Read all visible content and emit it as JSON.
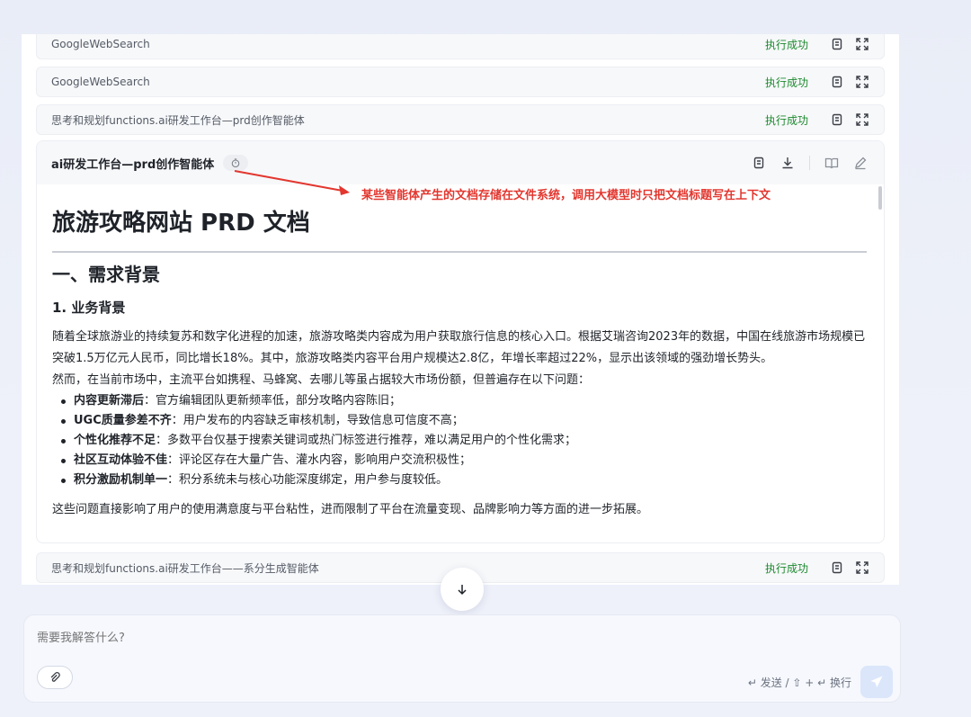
{
  "tool_rows": [
    {
      "name": "GoogleWebSearch",
      "status": "执行成功"
    },
    {
      "name": "GoogleWebSearch",
      "status": "执行成功"
    },
    {
      "name": "思考和规划functions.ai研发工作台—prd创作智能体",
      "status": "执行成功"
    },
    {
      "name": "思考和规划functions.ai研发工作台——系分生成智能体",
      "status": "执行成功"
    }
  ],
  "doc_card": {
    "title": "ai研发工作台—prd创作智能体",
    "doc_title": "旅游攻略网站 PRD 文档",
    "section": "一、需求背景",
    "subsection": "1. 业务背景",
    "paragraph1": "随着全球旅游业的持续复苏和数字化进程的加速，旅游攻略类内容成为用户获取旅行信息的核心入口。根据艾瑞咨询2023年的数据，中国在线旅游市场规模已突破1.5万亿元人民币，同比增长18%。其中，旅游攻略类内容平台用户规模达2.8亿，年增长率超过22%，显示出该领域的强劲增长势头。",
    "paragraph2": "然而，在当前市场中，主流平台如携程、马蜂窝、去哪儿等虽占据较大市场份额，但普遍存在以下问题：",
    "bullets": [
      {
        "bold": "内容更新滞后",
        "text": "：官方编辑团队更新频率低，部分攻略内容陈旧；"
      },
      {
        "bold": "UGC质量参差不齐",
        "text": "：用户发布的内容缺乏审核机制，导致信息可信度不高；"
      },
      {
        "bold": "个性化推荐不足",
        "text": "：多数平台仅基于搜索关键词或热门标签进行推荐，难以满足用户的个性化需求；"
      },
      {
        "bold": "社区互动体验不佳",
        "text": "：评论区存在大量广告、灌水内容，影响用户交流积极性；"
      },
      {
        "bold": "积分激励机制单一",
        "text": "：积分系统未与核心功能深度绑定，用户参与度较低。"
      }
    ],
    "paragraph3": "这些问题直接影响了用户的使用满意度与平台粘性，进而限制了平台在流量变现、品牌影响力等方面的进一步拓展。"
  },
  "annotation": "某些智能体产生的文档存储在文件系统，调用大模型时只把文档标题写在上下文",
  "chat": {
    "placeholder": "需要我解答什么?",
    "send_hint": "↵ 发送 / ⇧ + ↵ 换行"
  },
  "colors": {
    "success": "#1c8a2e",
    "annotation": "#e2372f",
    "send_button": "#dbe6fb"
  },
  "icons": [
    "copy-icon",
    "expand-icon",
    "timer-icon",
    "download-icon",
    "book-icon",
    "edit-icon",
    "arrow-down-icon",
    "paperclip-icon",
    "send-icon"
  ]
}
